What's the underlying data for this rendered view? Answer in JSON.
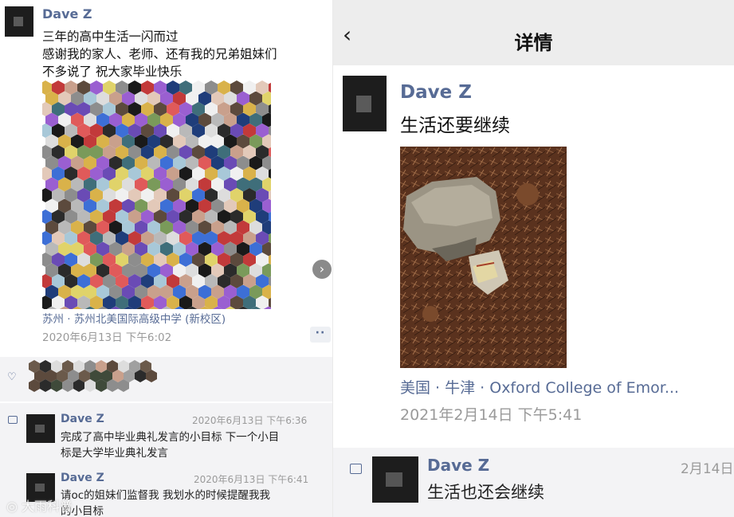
{
  "left_post": {
    "author": "Dave Z",
    "text_lines": [
      "三年的高中生活一闪而过",
      "感谢我的家人、老师、还有我的兄弟姐妹们",
      "不多说了 祝大家毕业快乐"
    ],
    "location": "苏州 · 苏州北美国际高级中学 (新校区)",
    "time": "2020年6月13日 下午6:02",
    "next_icon": "chevron-right-icon",
    "more_icon": "more-dots-icon",
    "like_icon": "heart-icon",
    "comment_icon": "comment-icon",
    "comments": [
      {
        "name": "Dave Z",
        "time": "2020年6月13日 下午6:36",
        "lines": [
          "完成了高中毕业典礼发言的小目标 下一个小目",
          "标是大学毕业典礼发言"
        ]
      },
      {
        "name": "Dave Z",
        "time": "2020年6月13日 下午6:41",
        "lines": [
          "请oc的姐妹们监督我 我划水的时候提醒我我",
          "的小目标"
        ]
      }
    ]
  },
  "watermark": "大雨科普",
  "detail": {
    "header_title": "详情",
    "back_icon": "back-arrow-icon",
    "author": "Dave Z",
    "text": "生活还要继续",
    "location": "美国 · 牛津 · Oxford College of Emor...",
    "time": "2021年2月14日 下午5:41",
    "comment_icon": "comment-icon",
    "comment": {
      "name": "Dave Z",
      "time": "2月14日",
      "text": "生活也还会继续"
    }
  }
}
